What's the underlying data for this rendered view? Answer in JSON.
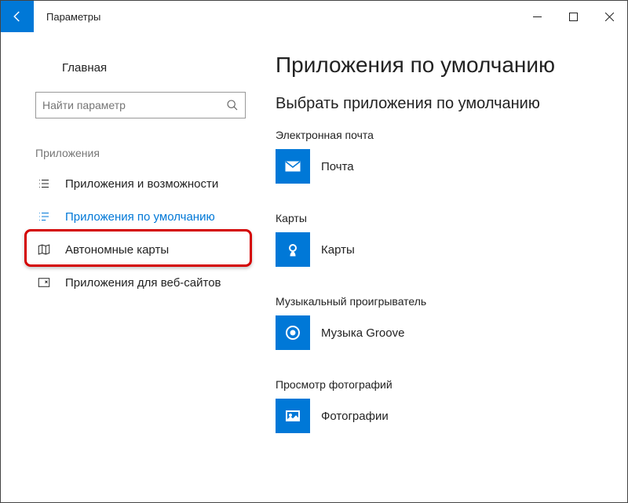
{
  "window": {
    "title": "Параметры"
  },
  "sidebar": {
    "home": "Главная",
    "search_placeholder": "Найти параметр",
    "category": "Приложения",
    "items": [
      {
        "label": "Приложения и возможности"
      },
      {
        "label": "Приложения по умолчанию"
      },
      {
        "label": "Автономные карты"
      },
      {
        "label": "Приложения для веб-сайтов"
      }
    ]
  },
  "main": {
    "heading": "Приложения по умолчанию",
    "subheading": "Выбрать приложения по умолчанию",
    "groups": [
      {
        "label": "Электронная почта",
        "app": "Почта"
      },
      {
        "label": "Карты",
        "app": "Карты"
      },
      {
        "label": "Музыкальный проигрыватель",
        "app": "Музыка Groove"
      },
      {
        "label": "Просмотр фотографий",
        "app": "Фотографии"
      }
    ]
  }
}
